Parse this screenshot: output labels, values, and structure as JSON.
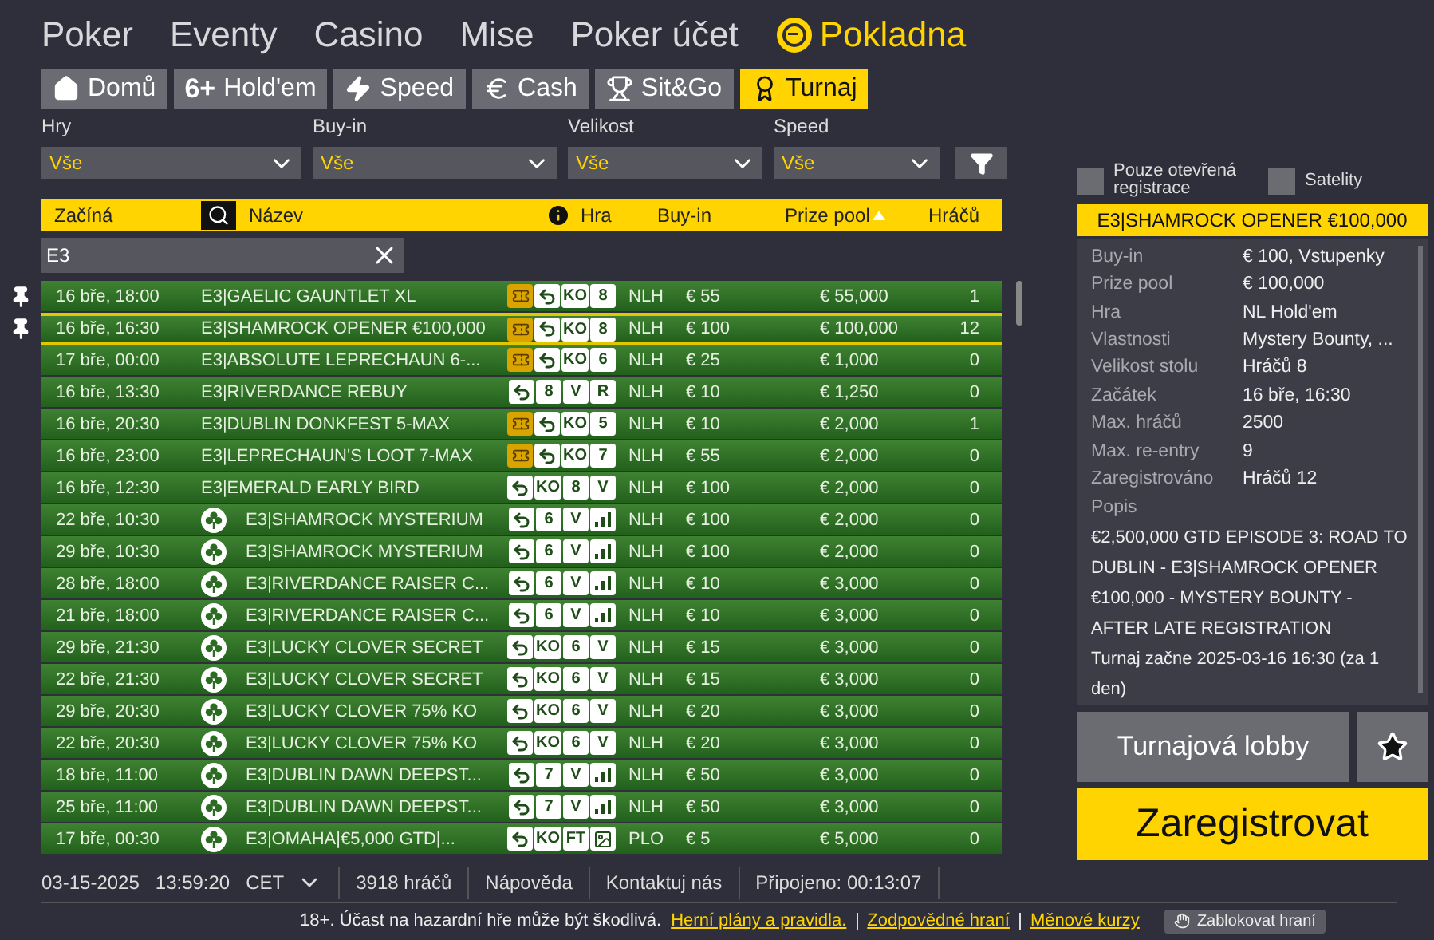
{
  "nav": [
    {
      "label": "Poker",
      "kind": "link"
    },
    {
      "label": "Eventy",
      "kind": "link"
    },
    {
      "label": "Casino",
      "kind": "link"
    },
    {
      "label": "Mise",
      "kind": "link"
    },
    {
      "label": "Poker účet",
      "kind": "link"
    },
    {
      "label": "Pokladna",
      "kind": "cashier"
    }
  ],
  "tabs": [
    {
      "label": "Domů",
      "kind": "home",
      "selected": false
    },
    {
      "label": "Hold'em",
      "kind": "holdem",
      "badge": "6+",
      "selected": false
    },
    {
      "label": "Speed",
      "kind": "bolt",
      "selected": false
    },
    {
      "label": "Cash",
      "kind": "euro",
      "selected": false
    },
    {
      "label": "Sit&Go",
      "kind": "trophy",
      "selected": false
    },
    {
      "label": "Turnaj",
      "kind": "cup",
      "selected": true
    }
  ],
  "filters": [
    {
      "label": "Hry",
      "value": "Vše"
    },
    {
      "label": "Buy-in",
      "value": "Vše"
    },
    {
      "label": "Velikost",
      "value": "Vše"
    },
    {
      "label": "Speed",
      "value": "Vše"
    }
  ],
  "options": [
    {
      "label": "Pouze otevřená registrace",
      "checked": false
    },
    {
      "label": "Satelity",
      "checked": false
    }
  ],
  "columns": [
    {
      "label": "Začíná",
      "kind": "start"
    },
    {
      "label": "Název",
      "kind": "name"
    },
    {
      "label": "Hra",
      "kind": "game"
    },
    {
      "label": "Buy-in",
      "kind": "buyin"
    },
    {
      "label": "Prize pool",
      "kind": "prize",
      "sorted": true
    },
    {
      "label": "Hráčů",
      "kind": "players"
    }
  ],
  "search": {
    "value": "E3"
  },
  "rows": [
    {
      "start": "16 bře, 18:00",
      "name": "E3|GAELIC GAUNTLET XL",
      "clover": false,
      "pinned": true,
      "selected": false,
      "badges": [
        {
          "kind": "ticket"
        },
        {
          "kind": "reentry"
        },
        {
          "kind": "text",
          "text": "KO"
        },
        {
          "kind": "text",
          "text": "8"
        }
      ],
      "game": "NLH",
      "buyin": "€ 55",
      "prize": "€ 55,000",
      "players": "1"
    },
    {
      "start": "16 bře, 16:30",
      "name": "E3|SHAMROCK OPENER €100,000",
      "clover": false,
      "pinned": true,
      "selected": true,
      "badges": [
        {
          "kind": "ticket"
        },
        {
          "kind": "reentry"
        },
        {
          "kind": "text",
          "text": "KO"
        },
        {
          "kind": "text",
          "text": "8"
        }
      ],
      "game": "NLH",
      "buyin": "€ 100",
      "prize": "€ 100,000",
      "players": "12"
    },
    {
      "start": "17 bře, 00:00",
      "name": "E3|ABSOLUTE LEPRECHAUN 6-...",
      "clover": false,
      "pinned": false,
      "selected": false,
      "badges": [
        {
          "kind": "ticket"
        },
        {
          "kind": "reentry"
        },
        {
          "kind": "text",
          "text": "KO"
        },
        {
          "kind": "text",
          "text": "6"
        }
      ],
      "game": "NLH",
      "buyin": "€ 25",
      "prize": "€ 1,000",
      "players": "0"
    },
    {
      "start": "16 bře, 13:30",
      "name": "E3|RIVERDANCE REBUY",
      "clover": false,
      "pinned": false,
      "selected": false,
      "badges": [
        {
          "kind": "reentry"
        },
        {
          "kind": "text",
          "text": "8"
        },
        {
          "kind": "text",
          "text": "V"
        },
        {
          "kind": "text",
          "text": "R"
        }
      ],
      "game": "NLH",
      "buyin": "€ 10",
      "prize": "€ 1,250",
      "players": "0"
    },
    {
      "start": "16 bře, 20:30",
      "name": "E3|DUBLIN DONKFEST 5-MAX",
      "clover": false,
      "pinned": false,
      "selected": false,
      "badges": [
        {
          "kind": "ticket"
        },
        {
          "kind": "reentry"
        },
        {
          "kind": "text",
          "text": "KO"
        },
        {
          "kind": "text",
          "text": "5"
        }
      ],
      "game": "NLH",
      "buyin": "€ 10",
      "prize": "€ 2,000",
      "players": "1"
    },
    {
      "start": "16 bře, 23:00",
      "name": "E3|LEPRECHAUN'S LOOT 7-MAX",
      "clover": false,
      "pinned": false,
      "selected": false,
      "badges": [
        {
          "kind": "ticket"
        },
        {
          "kind": "reentry"
        },
        {
          "kind": "text",
          "text": "KO"
        },
        {
          "kind": "text",
          "text": "7"
        }
      ],
      "game": "NLH",
      "buyin": "€ 55",
      "prize": "€ 2,000",
      "players": "0"
    },
    {
      "start": "16 bře, 12:30",
      "name": "E3|EMERALD EARLY BIRD",
      "clover": false,
      "pinned": false,
      "selected": false,
      "badges": [
        {
          "kind": "reentry"
        },
        {
          "kind": "text",
          "text": "KO"
        },
        {
          "kind": "text",
          "text": "8"
        },
        {
          "kind": "text",
          "text": "V"
        }
      ],
      "game": "NLH",
      "buyin": "€ 100",
      "prize": "€ 2,000",
      "players": "0"
    },
    {
      "start": "22 bře, 10:30",
      "name": "E3|SHAMROCK MYSTERIUM",
      "clover": true,
      "pinned": false,
      "selected": false,
      "badges": [
        {
          "kind": "reentry"
        },
        {
          "kind": "text",
          "text": "6"
        },
        {
          "kind": "text",
          "text": "V"
        },
        {
          "kind": "levels"
        }
      ],
      "game": "NLH",
      "buyin": "€ 100",
      "prize": "€ 2,000",
      "players": "0"
    },
    {
      "start": "29 bře, 10:30",
      "name": "E3|SHAMROCK MYSTERIUM",
      "clover": true,
      "pinned": false,
      "selected": false,
      "badges": [
        {
          "kind": "reentry"
        },
        {
          "kind": "text",
          "text": "6"
        },
        {
          "kind": "text",
          "text": "V"
        },
        {
          "kind": "levels"
        }
      ],
      "game": "NLH",
      "buyin": "€ 100",
      "prize": "€ 2,000",
      "players": "0"
    },
    {
      "start": "28 bře, 18:00",
      "name": "E3|RIVERDANCE RAISER C...",
      "clover": true,
      "pinned": false,
      "selected": false,
      "badges": [
        {
          "kind": "reentry"
        },
        {
          "kind": "text",
          "text": "6"
        },
        {
          "kind": "text",
          "text": "V"
        },
        {
          "kind": "levels"
        }
      ],
      "game": "NLH",
      "buyin": "€ 10",
      "prize": "€ 3,000",
      "players": "0"
    },
    {
      "start": "21 bře, 18:00",
      "name": "E3|RIVERDANCE RAISER C...",
      "clover": true,
      "pinned": false,
      "selected": false,
      "badges": [
        {
          "kind": "reentry"
        },
        {
          "kind": "text",
          "text": "6"
        },
        {
          "kind": "text",
          "text": "V"
        },
        {
          "kind": "levels"
        }
      ],
      "game": "NLH",
      "buyin": "€ 10",
      "prize": "€ 3,000",
      "players": "0"
    },
    {
      "start": "29 bře, 21:30",
      "name": "E3|LUCKY CLOVER SECRET",
      "clover": true,
      "pinned": false,
      "selected": false,
      "badges": [
        {
          "kind": "reentry"
        },
        {
          "kind": "text",
          "text": "KO"
        },
        {
          "kind": "text",
          "text": "6"
        },
        {
          "kind": "text",
          "text": "V"
        }
      ],
      "game": "NLH",
      "buyin": "€ 15",
      "prize": "€ 3,000",
      "players": "0"
    },
    {
      "start": "22 bře, 21:30",
      "name": "E3|LUCKY CLOVER SECRET",
      "clover": true,
      "pinned": false,
      "selected": false,
      "badges": [
        {
          "kind": "reentry"
        },
        {
          "kind": "text",
          "text": "KO"
        },
        {
          "kind": "text",
          "text": "6"
        },
        {
          "kind": "text",
          "text": "V"
        }
      ],
      "game": "NLH",
      "buyin": "€ 15",
      "prize": "€ 3,000",
      "players": "0"
    },
    {
      "start": "29 bře, 20:30",
      "name": "E3|LUCKY CLOVER 75% KO",
      "clover": true,
      "pinned": false,
      "selected": false,
      "badges": [
        {
          "kind": "reentry"
        },
        {
          "kind": "text",
          "text": "KO"
        },
        {
          "kind": "text",
          "text": "6"
        },
        {
          "kind": "text",
          "text": "V"
        }
      ],
      "game": "NLH",
      "buyin": "€ 20",
      "prize": "€ 3,000",
      "players": "0"
    },
    {
      "start": "22 bře, 20:30",
      "name": "E3|LUCKY CLOVER 75% KO",
      "clover": true,
      "pinned": false,
      "selected": false,
      "badges": [
        {
          "kind": "reentry"
        },
        {
          "kind": "text",
          "text": "KO"
        },
        {
          "kind": "text",
          "text": "6"
        },
        {
          "kind": "text",
          "text": "V"
        }
      ],
      "game": "NLH",
      "buyin": "€ 20",
      "prize": "€ 3,000",
      "players": "0"
    },
    {
      "start": "18 bře, 11:00",
      "name": "E3|DUBLIN DAWN DEEPST...",
      "clover": true,
      "pinned": false,
      "selected": false,
      "badges": [
        {
          "kind": "reentry"
        },
        {
          "kind": "text",
          "text": "7"
        },
        {
          "kind": "text",
          "text": "V"
        },
        {
          "kind": "levels"
        }
      ],
      "game": "NLH",
      "buyin": "€ 50",
      "prize": "€ 3,000",
      "players": "0"
    },
    {
      "start": "25 bře, 11:00",
      "name": "E3|DUBLIN DAWN DEEPST...",
      "clover": true,
      "pinned": false,
      "selected": false,
      "badges": [
        {
          "kind": "reentry"
        },
        {
          "kind": "text",
          "text": "7"
        },
        {
          "kind": "text",
          "text": "V"
        },
        {
          "kind": "levels"
        }
      ],
      "game": "NLH",
      "buyin": "€ 50",
      "prize": "€ 3,000",
      "players": "0"
    },
    {
      "start": "17 bře, 00:30",
      "name": "E3|OMAHA|€5,000 GTD|...",
      "clover": true,
      "pinned": false,
      "selected": false,
      "badges": [
        {
          "kind": "reentry"
        },
        {
          "kind": "text",
          "text": "KO"
        },
        {
          "kind": "text",
          "text": "FT"
        },
        {
          "kind": "image"
        }
      ],
      "game": "PLO",
      "buyin": "€ 5",
      "prize": "€ 5,000",
      "players": "0"
    }
  ],
  "details": {
    "title": "E3|SHAMROCK OPENER €100,000",
    "fields": [
      {
        "label": "Buy-in",
        "value": "€ 100, Vstupenky"
      },
      {
        "label": "Prize pool",
        "value": "€ 100,000"
      },
      {
        "label": "Hra",
        "value": "NL Hold'em"
      },
      {
        "label": "Vlastnosti",
        "value": "Mystery Bounty, ..."
      },
      {
        "label": "Velikost stolu",
        "value": "Hráčů 8"
      },
      {
        "label": "Začátek",
        "value": "16 bře, 16:30"
      },
      {
        "label": "Max. hráčů",
        "value": "2500"
      },
      {
        "label": "Max. re-entry",
        "value": "9"
      },
      {
        "label": "Zaregistrováno",
        "value": "Hráčů 12"
      }
    ],
    "description_label": "Popis",
    "description": "€2,500,000 GTD EPISODE 3: ROAD TO DUBLIN - E3|SHAMROCK OPENER €100,000 - MYSTERY BOUNTY - AFTER LATE REGISTRATION",
    "note": "Turnaj začne 2025-03-16 16:30 (za 1 den)"
  },
  "lobby_button": "Turnajová lobby",
  "register_button": "Zaregistrovat",
  "status_bar": {
    "date": "03-15-2025",
    "time": "13:59:20",
    "zone": "CET",
    "items": [
      "3918 hráčů",
      "Nápověda",
      "Kontaktuj nás",
      "Připojeno: 00:13:07"
    ]
  },
  "footer": {
    "text": "18+. Účast na hazardní hře může být škodlivá.",
    "links": [
      "Herní plány a pravidla.",
      "Zodpovědné hraní",
      "Měnové kurzy"
    ],
    "block_button": "Zablokovat hraní"
  }
}
